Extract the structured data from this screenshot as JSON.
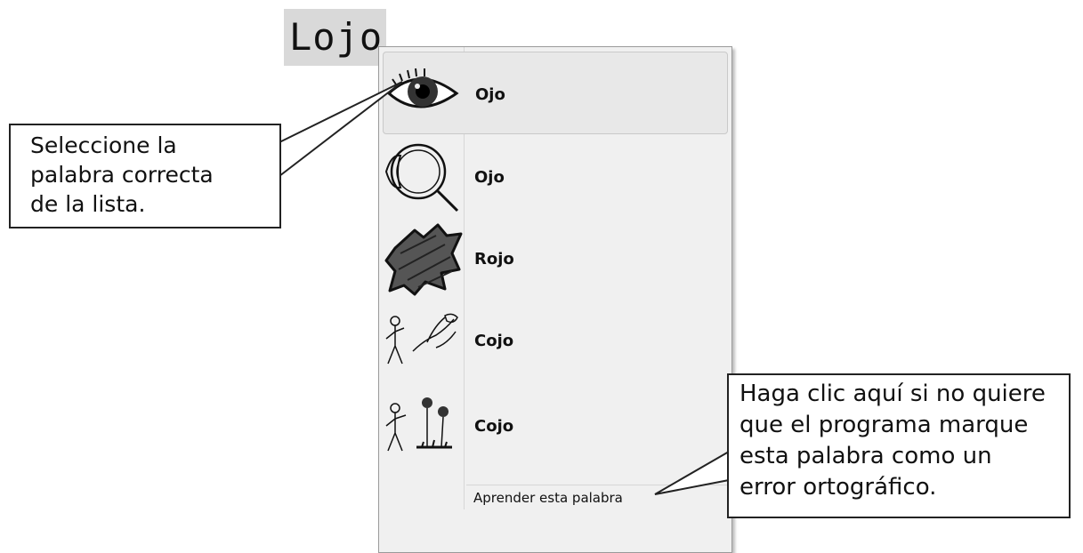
{
  "misspelled_word": "Lojo",
  "suggestions": [
    {
      "label": "Ojo",
      "icon": "eye-icon"
    },
    {
      "label": "Ojo",
      "icon": "eyeball-anatomy-icon"
    },
    {
      "label": "Rojo",
      "icon": "red-scribble-icon"
    },
    {
      "label": "Cojo",
      "icon": "person-grab-icon"
    },
    {
      "label": "Cojo",
      "icon": "person-pick-flowers-icon"
    }
  ],
  "learn_word_label": "Aprender esta palabra",
  "callouts": {
    "left": [
      "Seleccione la",
      "palabra correcta",
      "de la lista."
    ],
    "right": [
      "Haga clic aquí si no quiere",
      "que el programa marque",
      "esta palabra como un",
      "error ortográfico."
    ]
  }
}
